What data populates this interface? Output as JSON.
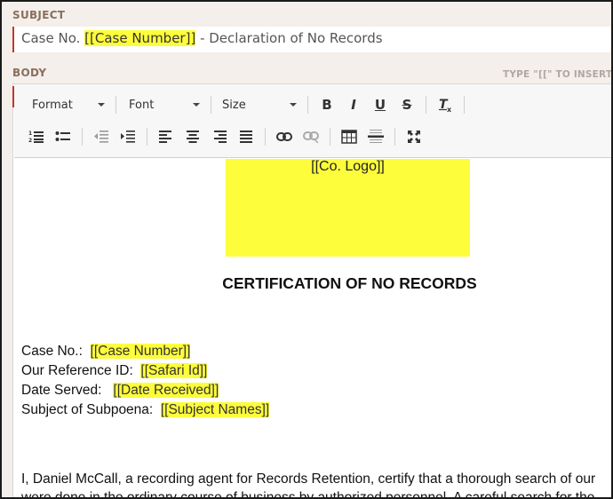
{
  "subject": {
    "label": "SUBJECT",
    "prefix": "Case No. ",
    "token": "[[Case Number]]",
    "suffix": " - Declaration of No Records"
  },
  "body": {
    "label": "BODY",
    "insert_hint": "TYPE \"[[\" TO INSERT A R"
  },
  "toolbar": {
    "format": "Format",
    "font": "Font",
    "size": "Size",
    "bold": "B",
    "italic": "I",
    "underline": "U",
    "strike": "S"
  },
  "document": {
    "logo": "[[Co. Logo]]",
    "title": "CERTIFICATION OF NO RECORDS",
    "fields": [
      {
        "label": "Case No.:",
        "token": "[[Case Number]]"
      },
      {
        "label": "Our Reference ID:",
        "token": "[[Safari Id]]"
      },
      {
        "label": "Date Served:",
        "token": "[[Date Received]]"
      },
      {
        "label": "Subject of Subpoena:",
        "token": "[[Subject Names]]"
      }
    ],
    "paragraph_line1": "I, Daniel McCall, a recording agent for Records Retention, certify that a thorough search of our",
    "paragraph_line2": "were done in the ordinary course of business by authorized personnel. A careful search for the"
  },
  "colors": {
    "highlight": "#fdfd3c",
    "label": "#8a6f5c",
    "accent": "#c0392b"
  }
}
